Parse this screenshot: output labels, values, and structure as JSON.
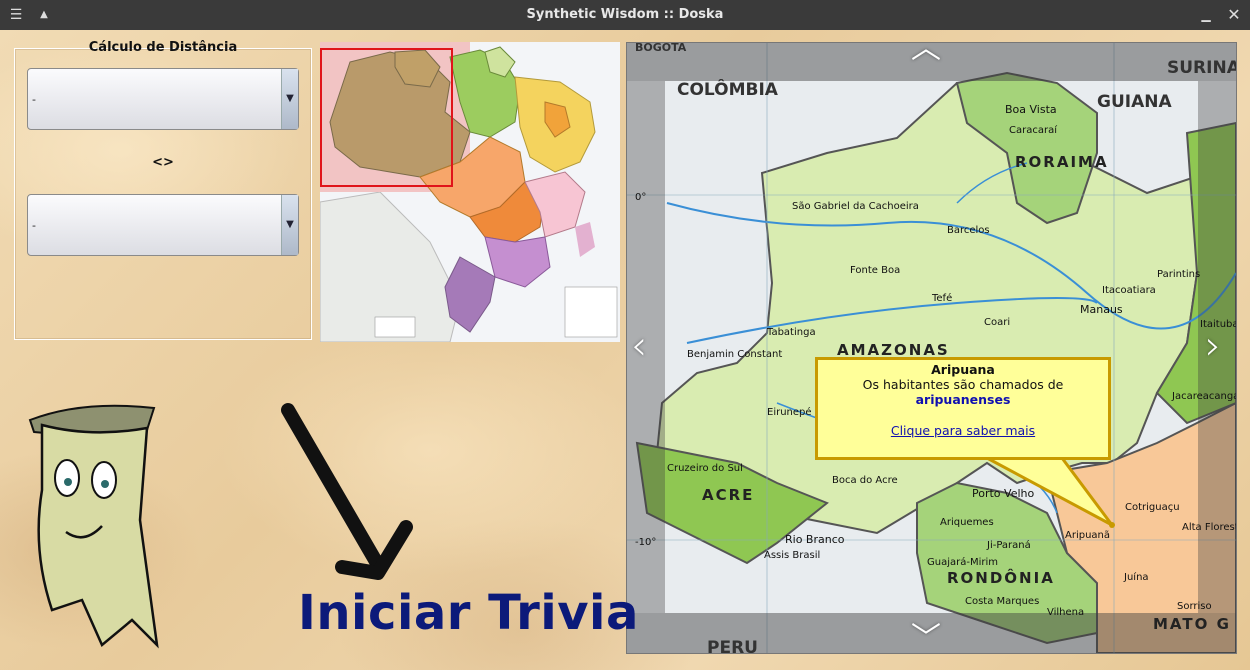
{
  "window": {
    "title": "Synthetic Wisdom :: Doska"
  },
  "distance": {
    "title": "Cálculo de Distância",
    "from_value": "-",
    "to_value": "-",
    "separator": "<>"
  },
  "trivia": {
    "button_label": "Iniciar Trivia"
  },
  "map": {
    "countries": [
      "COLÔMBIA",
      "GUIANA",
      "SURINA",
      "PERU",
      "BOGOTA"
    ],
    "states": [
      "RORAIMA",
      "AMAZONAS",
      "ACRE",
      "RONDÔNIA",
      "MATO G"
    ],
    "cities": [
      "Boa Vista",
      "Caracaraí",
      "São Gabriel da Cachoeira",
      "Barcelos",
      "Fonte Boa",
      "Tefé",
      "Coari",
      "Manaus",
      "Itacoatiara",
      "Parintins",
      "Tabatinga",
      "Benjamin Constant",
      "Eirunepé",
      "Cruzeiro do Sul",
      "Boca do Acre",
      "Porto Velho",
      "Ariquemes",
      "Ji-Paraná",
      "Guajará-Mirim",
      "Costa Marques",
      "Vilhena",
      "Rio Branco",
      "Assis Brasil",
      "Cotriguaçu",
      "Aripuanã",
      "Juína",
      "Alta Floresta",
      "Sorriso",
      "Itaituba",
      "Jacareacanga"
    ],
    "lat_labels": [
      "0°",
      "-10°"
    ],
    "accent": "#c89a00"
  },
  "popup": {
    "place": "Aripuana",
    "text": "Os habitantes são chamados de",
    "demonym": "aripuanenses",
    "link": "Clique para saber mais"
  },
  "icons": {
    "menu": "menu-icon",
    "pin": "pin-icon",
    "minimize": "minimize-icon",
    "close": "close-icon"
  }
}
